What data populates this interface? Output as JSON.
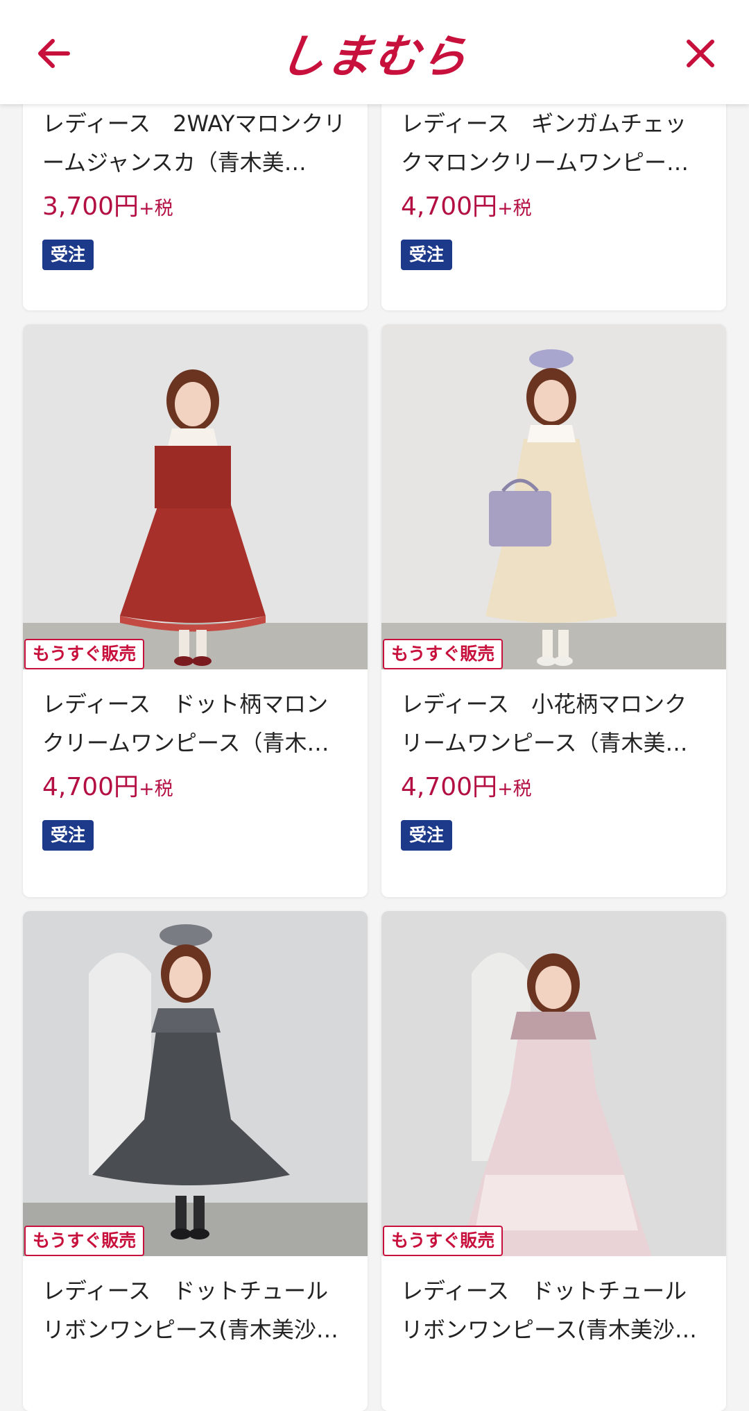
{
  "header": {
    "logo": "しまむら",
    "back_icon": "arrow-left-icon",
    "close_icon": "close-icon"
  },
  "colors": {
    "brand": "#c8103c",
    "price": "#b30f43",
    "badge": "#1d3a8a"
  },
  "products": [
    {
      "name": "レディース　2WAYマロンクリームジャンスカ（青木美…",
      "price": "3,700円",
      "tax": "+税",
      "badge": "受注",
      "status": ""
    },
    {
      "name": "レディース　ギンガムチェックマロンクリームワンピー…",
      "price": "4,700円",
      "tax": "+税",
      "badge": "受注",
      "status": ""
    },
    {
      "name": "レディース　ドット柄マロンクリームワンピース（青木…",
      "price": "4,700円",
      "tax": "+税",
      "badge": "受注",
      "status": "もうすぐ販売"
    },
    {
      "name": "レディース　小花柄マロンクリームワンピース（青木美…",
      "price": "4,700円",
      "tax": "+税",
      "badge": "受注",
      "status": "もうすぐ販売"
    },
    {
      "name": "レディース　ドットチュールリボンワンピース(青木美沙…",
      "price": "",
      "tax": "",
      "badge": "",
      "status": "もうすぐ販売"
    },
    {
      "name": "レディース　ドットチュールリボンワンピース(青木美沙…",
      "price": "",
      "tax": "",
      "badge": "",
      "status": "もうすぐ販売"
    }
  ]
}
